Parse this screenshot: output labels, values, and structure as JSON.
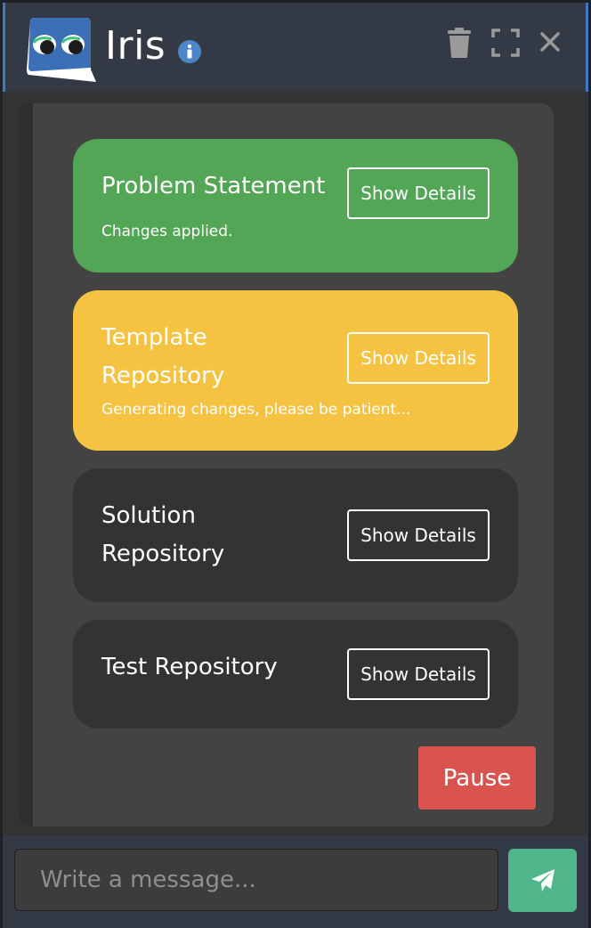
{
  "header": {
    "title": "Iris",
    "icons": {
      "logo": "iris-logo",
      "info": "info-circle-icon",
      "trash": "trash-icon",
      "fullscreen": "expand-icon",
      "close": "close-icon"
    }
  },
  "stages": [
    {
      "title": "Problem Statement",
      "status": "Changes applied.",
      "button_label": "Show Details",
      "state": "done",
      "color": "#52a655"
    },
    {
      "title": "Template Repository",
      "status": "Generating changes, please be patient...",
      "button_label": "Show Details",
      "state": "in-progress",
      "color": "#f5c242"
    },
    {
      "title": "Solution Repository",
      "status": "",
      "button_label": "Show Details",
      "state": "pending",
      "color": "#333333"
    },
    {
      "title": "Test Repository",
      "status": "",
      "button_label": "Show Details",
      "state": "pending",
      "color": "#333333"
    }
  ],
  "controls": {
    "pause_label": "Pause",
    "pause_color": "#d9534f"
  },
  "composer": {
    "placeholder": "Write a message...",
    "value": "",
    "send_icon": "paper-plane-icon",
    "send_color": "#4fb58a"
  }
}
